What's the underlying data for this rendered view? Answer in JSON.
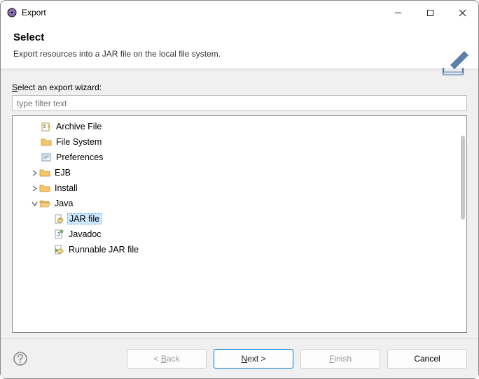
{
  "titlebar": {
    "title": "Export"
  },
  "header": {
    "heading": "Select",
    "description": "Export resources into a JAR file on the local file system."
  },
  "body": {
    "label_pre": "S",
    "label_post": "elect an export wizard:",
    "filter_placeholder": "type filter text"
  },
  "tree": {
    "items": [
      {
        "label": "Archive File",
        "type": "leaf",
        "icon": "archive",
        "indent": "leaf-1"
      },
      {
        "label": "File System",
        "type": "leaf",
        "icon": "filesystem",
        "indent": "leaf-1"
      },
      {
        "label": "Preferences",
        "type": "leaf",
        "icon": "prefs",
        "indent": "leaf-1"
      },
      {
        "label": "EJB",
        "type": "folder",
        "expanded": false,
        "indent": "1"
      },
      {
        "label": "Install",
        "type": "folder",
        "expanded": false,
        "indent": "1"
      },
      {
        "label": "Java",
        "type": "folder",
        "expanded": true,
        "indent": "1"
      },
      {
        "label": "JAR file",
        "type": "leaf",
        "icon": "jar",
        "indent": "leaf-2",
        "selected": true
      },
      {
        "label": "Javadoc",
        "type": "leaf",
        "icon": "javadoc",
        "indent": "leaf-2"
      },
      {
        "label": "Runnable JAR file",
        "type": "leaf",
        "icon": "runjar",
        "indent": "leaf-2"
      }
    ]
  },
  "footer": {
    "back": "< Back",
    "next": "Next >",
    "finish": "Finish",
    "cancel": "Cancel"
  }
}
